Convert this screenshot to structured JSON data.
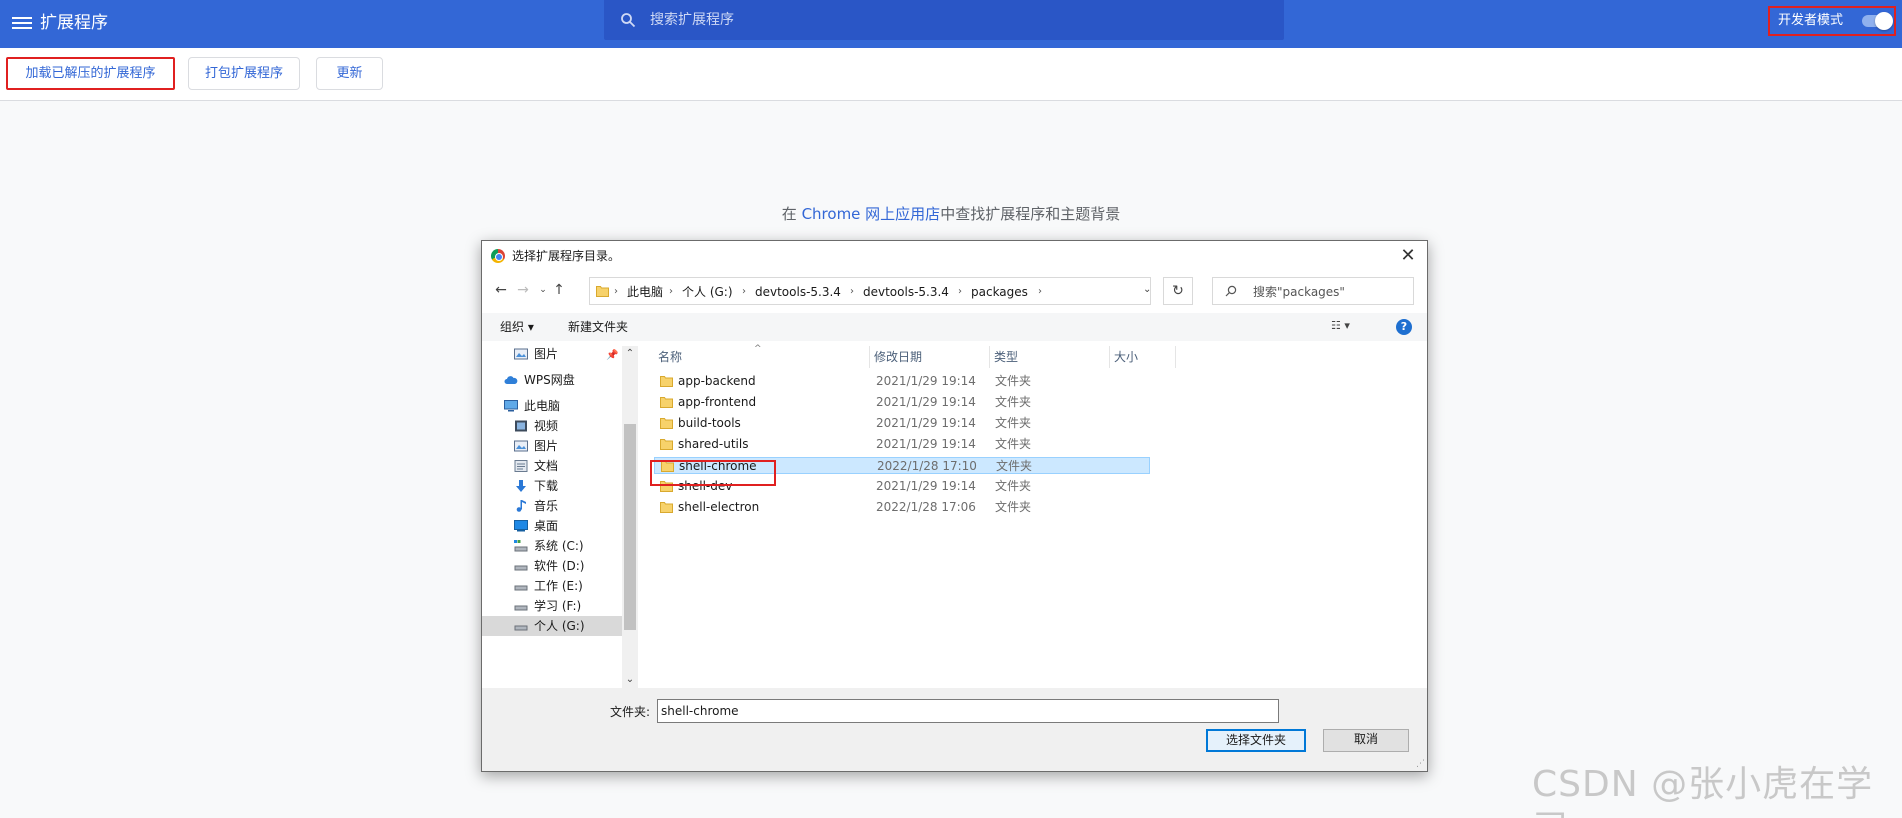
{
  "header": {
    "title": "扩展程序",
    "search_placeholder": "搜索扩展程序",
    "dev_mode_label": "开发者模式",
    "dev_mode_on": true
  },
  "toolbar": {
    "load_unpacked": "加载已解压的扩展程序",
    "pack": "打包扩展程序",
    "update": "更新"
  },
  "store_line": {
    "prefix": "在 ",
    "link": "Chrome 网上应用店",
    "suffix": "中查找扩展程序和主题背景"
  },
  "dialog": {
    "title": "选择扩展程序目录。",
    "breadcrumbs": [
      "此电脑",
      "个人 (G:)",
      "devtools-5.3.4",
      "devtools-5.3.4",
      "packages"
    ],
    "search_placeholder": "搜索\"packages\"",
    "commands": {
      "organize": "组织 ▾",
      "new_folder": "新建文件夹"
    },
    "nav": [
      {
        "label": "图片",
        "icon": "pictures-icon"
      },
      {
        "label": "WPS网盘",
        "icon": "cloud-icon"
      },
      {
        "label": "此电脑",
        "icon": "computer-icon"
      },
      {
        "label": "视频",
        "icon": "video-icon"
      },
      {
        "label": "图片",
        "icon": "pictures-icon"
      },
      {
        "label": "文档",
        "icon": "documents-icon"
      },
      {
        "label": "下载",
        "icon": "download-icon"
      },
      {
        "label": "音乐",
        "icon": "music-icon"
      },
      {
        "label": "桌面",
        "icon": "desktop-icon"
      },
      {
        "label": "系统 (C:)",
        "icon": "system-drive-icon"
      },
      {
        "label": "软件 (D:)",
        "icon": "drive-icon"
      },
      {
        "label": "工作 (E:)",
        "icon": "drive-icon"
      },
      {
        "label": "学习 (F:)",
        "icon": "drive-icon"
      },
      {
        "label": "个人 (G:)",
        "icon": "drive-icon"
      }
    ],
    "columns": {
      "name": "名称",
      "modified": "修改日期",
      "type": "类型",
      "size": "大小"
    },
    "files": [
      {
        "name": "app-backend",
        "date": "2021/1/29 19:14",
        "type": "文件夹"
      },
      {
        "name": "app-frontend",
        "date": "2021/1/29 19:14",
        "type": "文件夹"
      },
      {
        "name": "build-tools",
        "date": "2021/1/29 19:14",
        "type": "文件夹"
      },
      {
        "name": "shared-utils",
        "date": "2021/1/29 19:14",
        "type": "文件夹"
      },
      {
        "name": "shell-chrome",
        "date": "2022/1/28 17:10",
        "type": "文件夹"
      },
      {
        "name": "shell-dev",
        "date": "2021/1/29 19:14",
        "type": "文件夹"
      },
      {
        "name": "shell-electron",
        "date": "2022/1/28 17:06",
        "type": "文件夹"
      }
    ],
    "folder_label": "文件夹:",
    "folder_value": "shell-chrome",
    "select_button": "选择文件夹",
    "cancel_button": "取消"
  },
  "watermark": "CSDN @张小虎在学习",
  "colors": {
    "header_bg": "#3367d6",
    "accent": "#3367d6",
    "highlight": "#e02020",
    "selection": "#cce8ff"
  }
}
